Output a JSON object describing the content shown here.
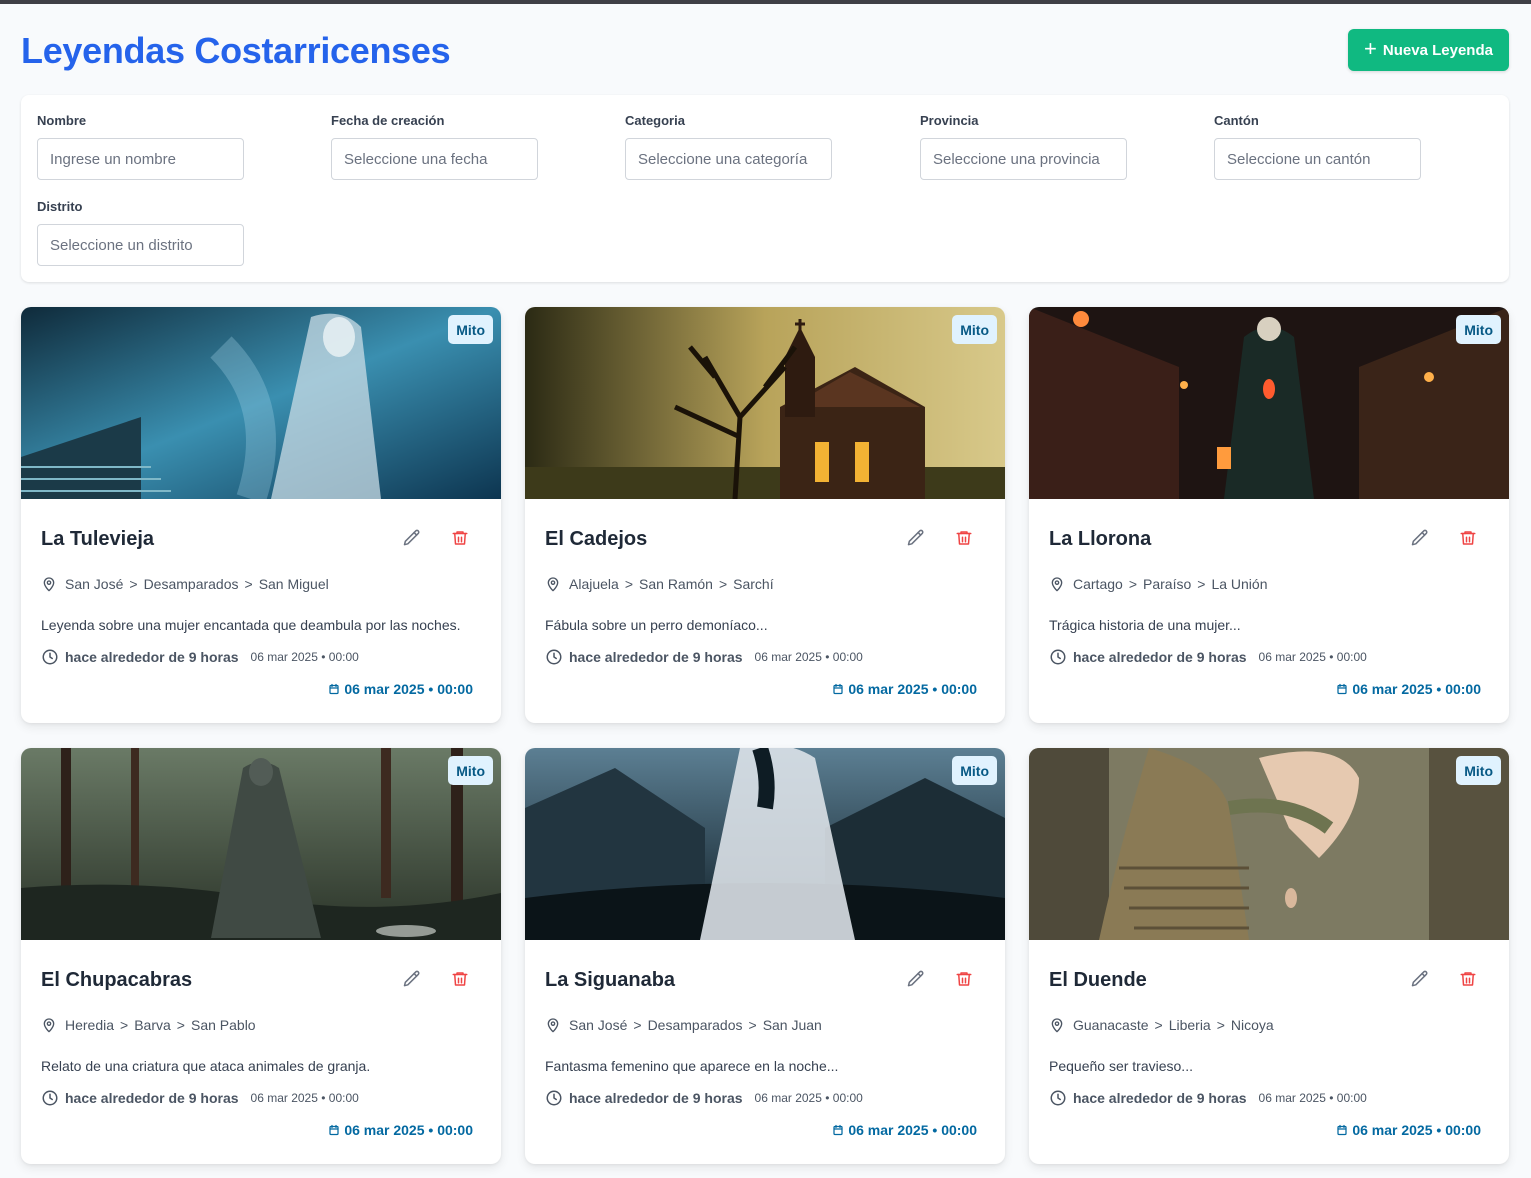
{
  "header": {
    "title": "Leyendas Costarricenses",
    "new_button_label": "Nueva Leyenda",
    "new_button_icon": "plus-icon"
  },
  "filters": {
    "nombre": {
      "label": "Nombre",
      "placeholder": "Ingrese un nombre"
    },
    "fecha": {
      "label": "Fecha de creación",
      "placeholder": "Seleccione una fecha"
    },
    "categoria": {
      "label": "Categoria",
      "placeholder": "Seleccione una categoría"
    },
    "provincia": {
      "label": "Provincia",
      "placeholder": "Seleccione una provincia"
    },
    "canton": {
      "label": "Cantón",
      "placeholder": "Seleccione un cantón"
    },
    "distrito": {
      "label": "Distrito",
      "placeholder": "Seleccione un distrito"
    }
  },
  "colors": {
    "title": "#2563eb",
    "primary_button": "#10b981",
    "badge_bg": "#e0f2fe",
    "badge_text": "#075985",
    "delete_icon": "#ef4444",
    "date_accent": "#0369a1"
  },
  "cards": [
    {
      "title": "La Tulevieja",
      "badge": "Mito",
      "provincia": "San José",
      "canton": "Desamparados",
      "distrito": "San Miguel",
      "description": "Leyenda sobre una mujer encantada que deambula por las noches.",
      "relative_time": "hace alrededor de 9 horas",
      "absolute_time": "06 mar 2025 • 00:00",
      "footer_date": "06 mar 2025 • 00:00"
    },
    {
      "title": "El Cadejos",
      "badge": "Mito",
      "provincia": "Alajuela",
      "canton": "San Ramón",
      "distrito": "Sarchí",
      "description": "Fábula sobre un perro demoníaco...",
      "relative_time": "hace alrededor de 9 horas",
      "absolute_time": "06 mar 2025 • 00:00",
      "footer_date": "06 mar 2025 • 00:00"
    },
    {
      "title": "La Llorona",
      "badge": "Mito",
      "provincia": "Cartago",
      "canton": "Paraíso",
      "distrito": "La Unión",
      "description": "Trágica historia de una mujer...",
      "relative_time": "hace alrededor de 9 horas",
      "absolute_time": "06 mar 2025 • 00:00",
      "footer_date": "06 mar 2025 • 00:00"
    },
    {
      "title": "El Chupacabras",
      "badge": "Mito",
      "provincia": "Heredia",
      "canton": "Barva",
      "distrito": "San Pablo",
      "description": "Relato de una criatura que ataca animales de granja.",
      "relative_time": "hace alrededor de 9 horas",
      "absolute_time": "06 mar 2025 • 00:00",
      "footer_date": "06 mar 2025 • 00:00"
    },
    {
      "title": "La Siguanaba",
      "badge": "Mito",
      "provincia": "San José",
      "canton": "Desamparados",
      "distrito": "San Juan",
      "description": "Fantasma femenino que aparece en la noche...",
      "relative_time": "hace alrededor de 9 horas",
      "absolute_time": "06 mar 2025 • 00:00",
      "footer_date": "06 mar 2025 • 00:00"
    },
    {
      "title": "El Duende",
      "badge": "Mito",
      "provincia": "Guanacaste",
      "canton": "Liberia",
      "distrito": "Nicoya",
      "description": "Pequeño ser travieso...",
      "relative_time": "hace alrededor de 9 horas",
      "absolute_time": "06 mar 2025 • 00:00",
      "footer_date": "06 mar 2025 • 00:00"
    }
  ]
}
